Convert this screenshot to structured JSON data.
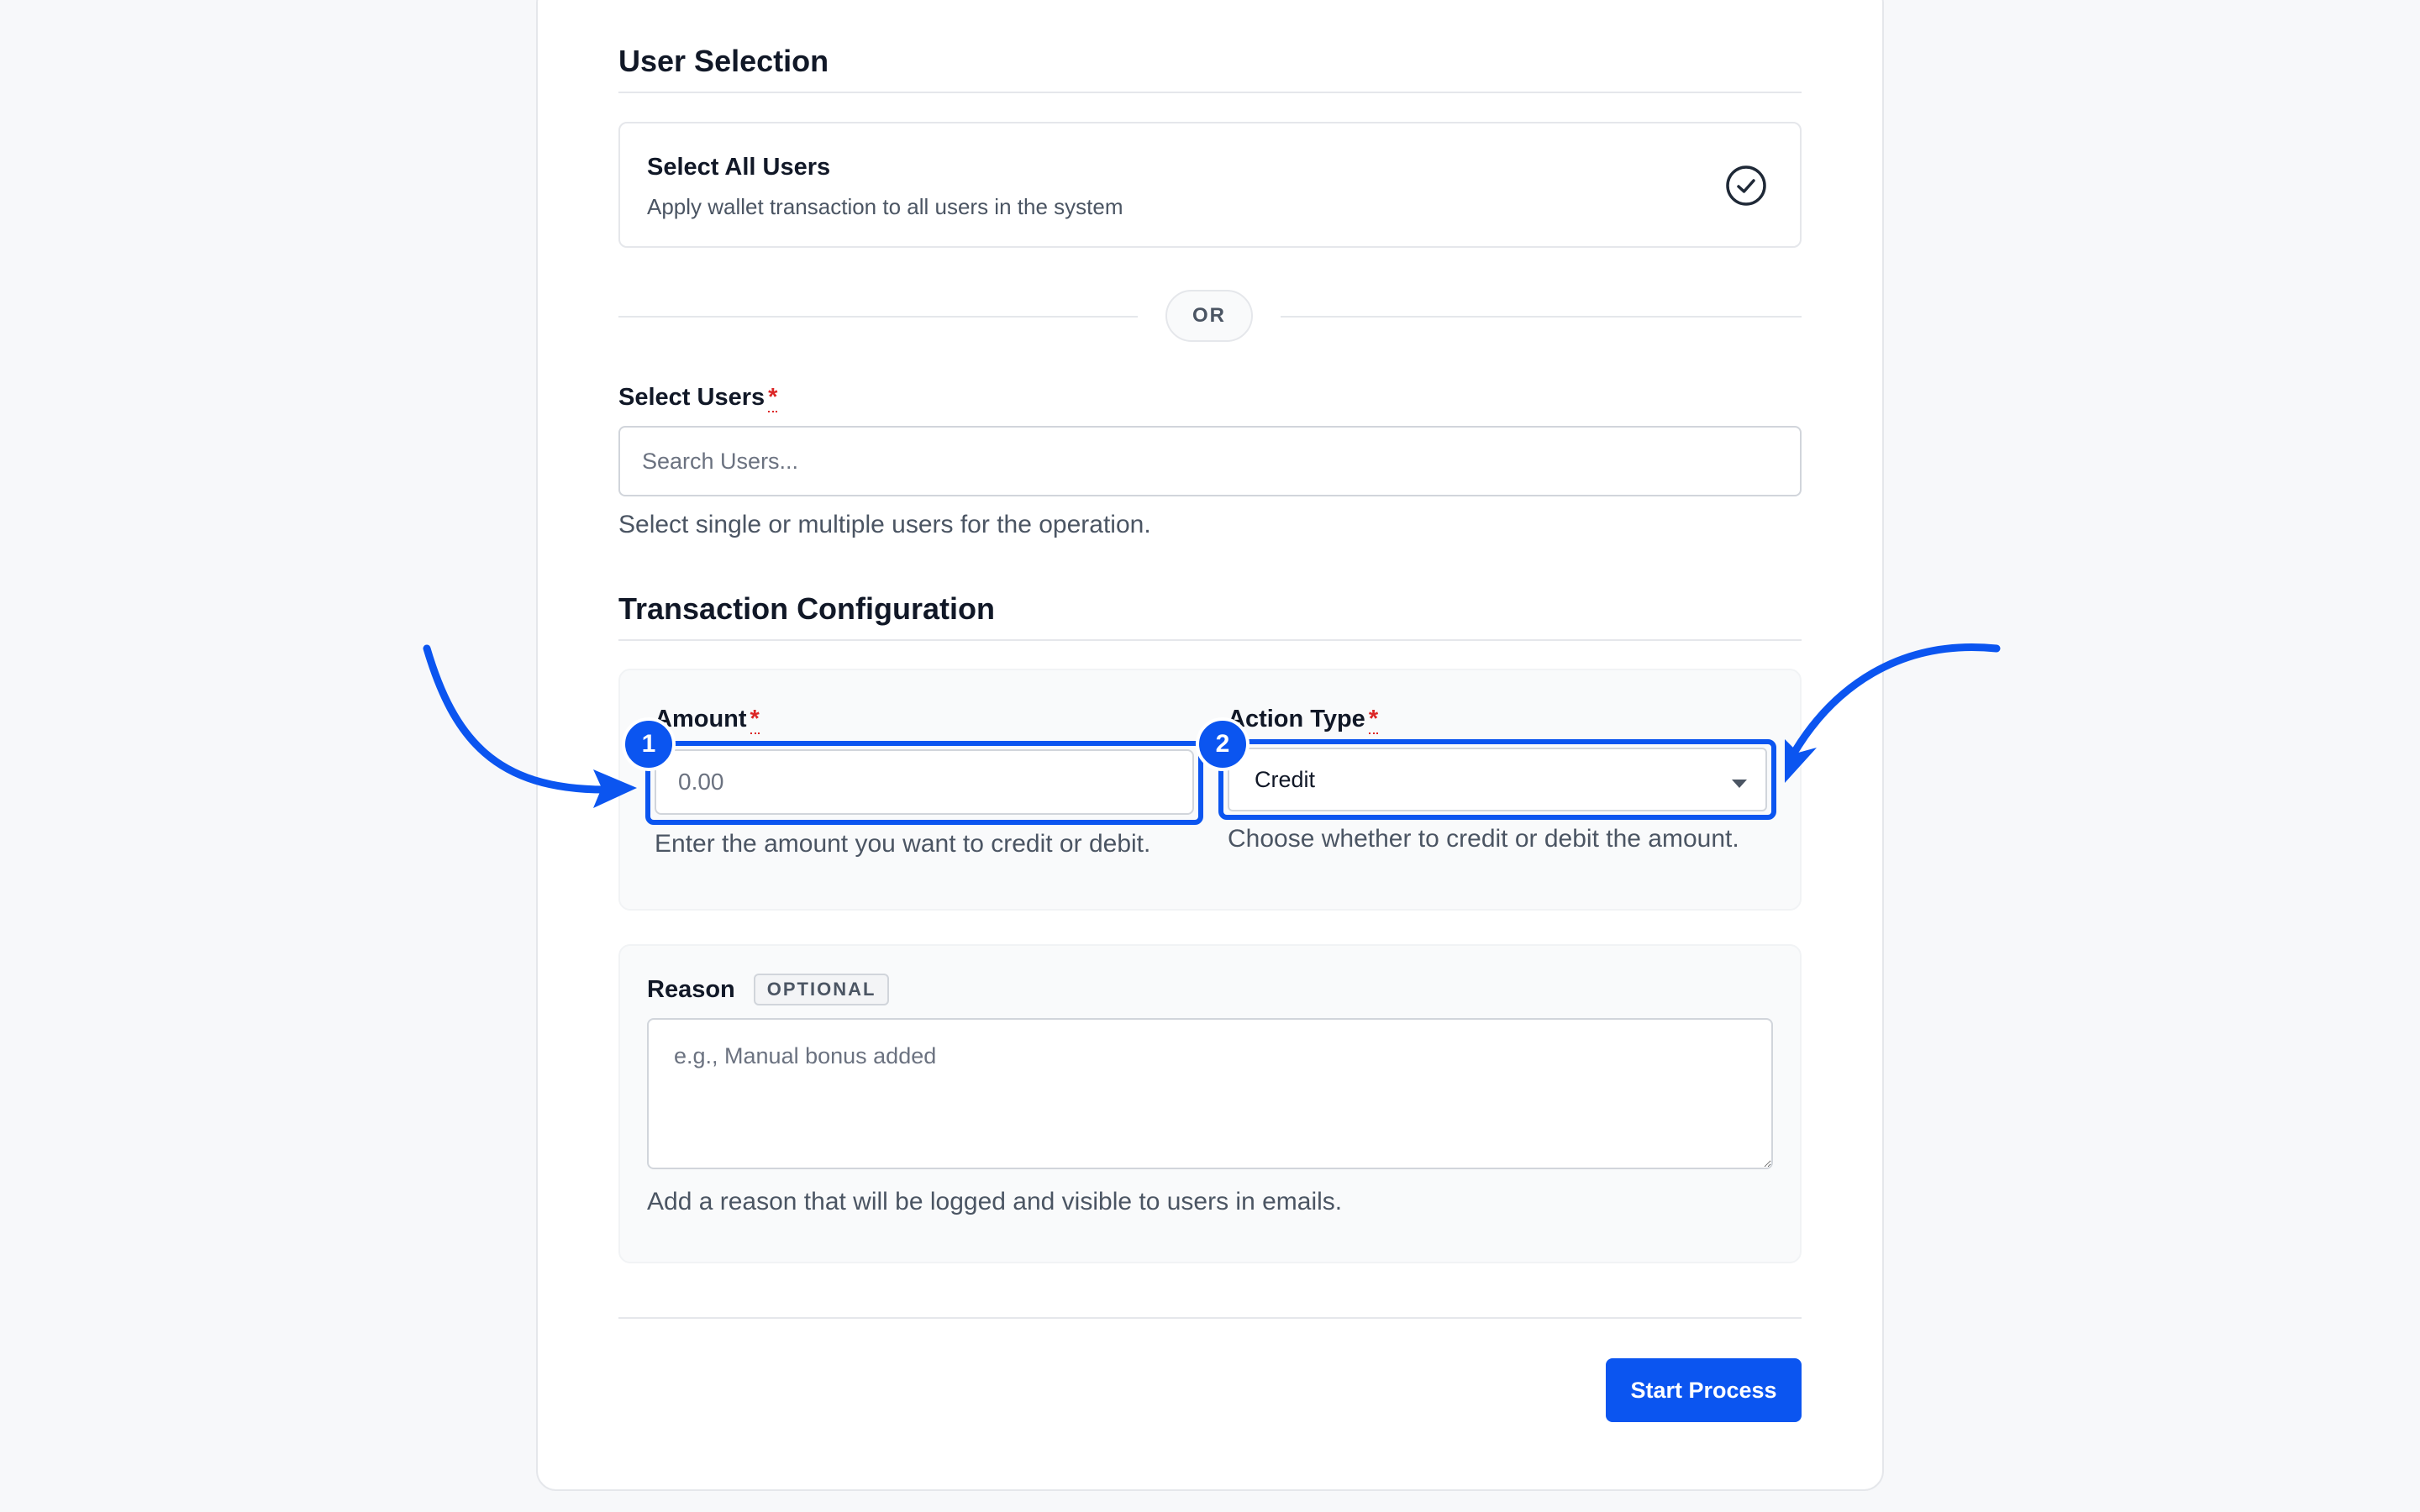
{
  "user_selection": {
    "title": "User Selection",
    "select_all": {
      "title": "Select All Users",
      "description": "Apply wallet transaction to all users in the system",
      "icon": "check-circle-icon"
    },
    "divider_text": "OR",
    "select_users": {
      "label": "Select Users",
      "required_mark": "*",
      "placeholder": "Search Users...",
      "help": "Select single or multiple users for the operation."
    }
  },
  "transaction": {
    "title": "Transaction Configuration",
    "amount": {
      "label": "Amount",
      "required_mark": "*",
      "placeholder": "0.00",
      "help": "Enter the amount you want to credit or debit.",
      "step_number": "1"
    },
    "action_type": {
      "label": "Action Type",
      "required_mark": "*",
      "value": "Credit",
      "help": "Choose whether to credit or debit the amount.",
      "step_number": "2"
    },
    "reason": {
      "label": "Reason",
      "badge": "OPTIONAL",
      "placeholder": "e.g., Manual bonus added",
      "help": "Add a reason that will be logged and visible to users in emails."
    }
  },
  "actions": {
    "start_label": "Start Process"
  },
  "colors": {
    "accent": "#0b55f0",
    "required": "#dc2626"
  }
}
